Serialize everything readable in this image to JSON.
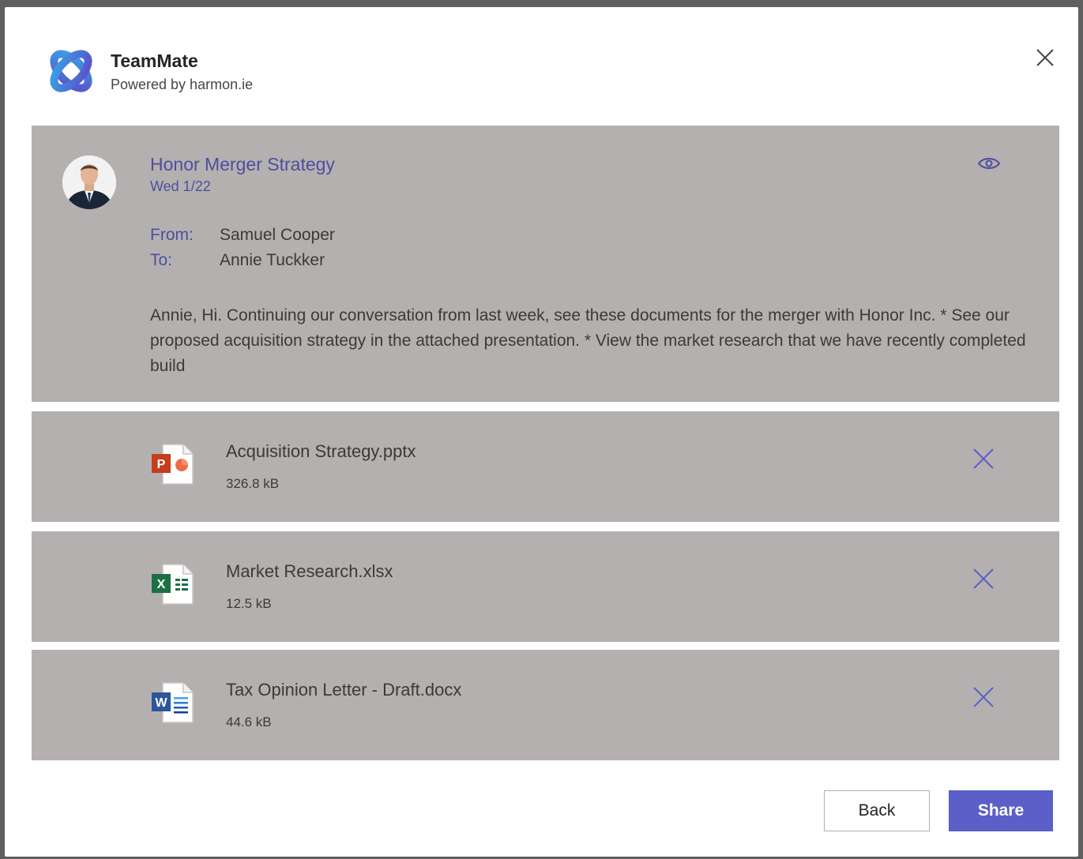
{
  "app": {
    "name": "TeamMate",
    "subtitle": "Powered by harmon.ie"
  },
  "email": {
    "subject": "Honor Merger Strategy",
    "date": "Wed 1/22",
    "from_label": "From:",
    "from": "Samuel Cooper",
    "to_label": "To:",
    "to": "Annie Tuckker",
    "body": "Annie,  Hi. Continuing our conversation from last week, see these documents for the merger with Honor Inc. * See our proposed acquisition strategy in the attached presentation. * View the market research that we have recently completed build"
  },
  "attachments": [
    {
      "name": "Acquisition Strategy.pptx",
      "size": "326.8 kB",
      "icon": "powerpoint-file-icon"
    },
    {
      "name": "Market Research.xlsx",
      "size": "12.5 kB",
      "icon": "excel-file-icon"
    },
    {
      "name": "Tax Opinion Letter - Draft.docx",
      "size": "44.6 kB",
      "icon": "word-file-icon"
    }
  ],
  "buttons": {
    "back": "Back",
    "share": "Share"
  },
  "colors": {
    "accent": "#5b5fc7",
    "link": "#4b4f9e",
    "panel": "#b5b0b0",
    "powerpoint": "#c43e1c",
    "excel": "#1d7044",
    "word": "#2b579a"
  }
}
